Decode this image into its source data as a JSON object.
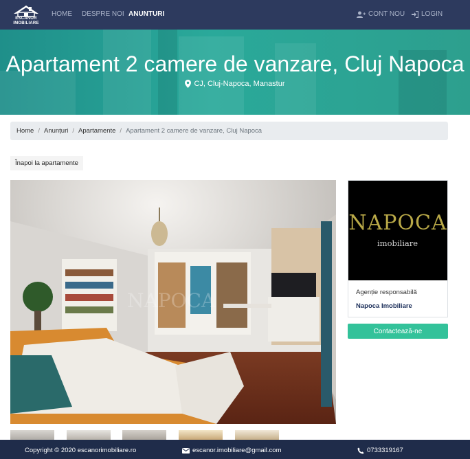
{
  "nav": {
    "logo_line1": "ESCANOR",
    "logo_line2": "IMOBILIARE",
    "links": [
      "HOME",
      "DESPRE NOI",
      "ANUNTURI"
    ],
    "signup": "CONT NOU",
    "login": "LOGIN",
    "signup_icon": "user-plus-icon",
    "login_icon": "sign-in-icon"
  },
  "hero": {
    "title": "Apartament 2 camere de vanzare, Cluj Napoca",
    "location": "CJ, Cluj-Napoca, Manastur",
    "location_icon": "map-marker-icon"
  },
  "breadcrumb": [
    "Home",
    "Anunțuri",
    "Apartamente",
    "Apartament 2 camere de vanzare, Cluj Napoca"
  ],
  "back_button": "Înapoi la apartamente",
  "agency": {
    "logo_text": "NAPOCA",
    "logo_sub": "imobiliare",
    "label": "Agenție responsabilă",
    "name": "Napoca Imobiliare",
    "contact_button": "Contactează-ne"
  },
  "footer": {
    "copyright": "Copyright © 2020 escanorimobiliare.ro",
    "email": "escanor.imobiliare@gmail.com",
    "phone": "0733319167",
    "email_icon": "envelope-icon",
    "phone_icon": "phone-icon"
  },
  "colors": {
    "navbar": "#2d3a5e",
    "hero": "#2aa99a",
    "accent": "#33c29a",
    "footer": "#1f2c4a"
  }
}
